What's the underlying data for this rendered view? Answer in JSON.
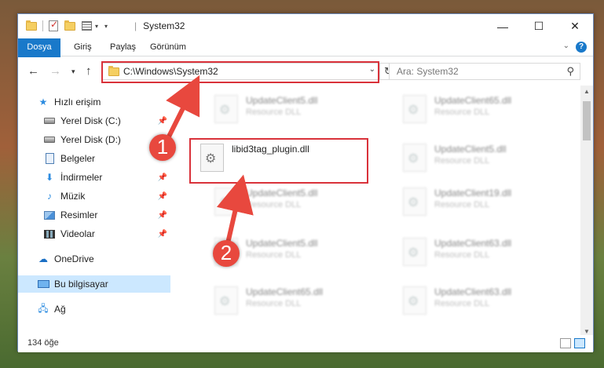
{
  "window": {
    "title": "System32",
    "controls": {
      "minimize": "—",
      "maximize": "☐",
      "close": "✕"
    }
  },
  "ribbon": {
    "tabs": [
      "Dosya",
      "Giriş",
      "Paylaş",
      "Görünüm"
    ],
    "help": "?"
  },
  "navbar": {
    "address": "C:\\Windows\\System32",
    "search_placeholder": "Ara: System32"
  },
  "sidebar": {
    "items": [
      {
        "label": "Hızlı erişim",
        "icon": "star-icon"
      },
      {
        "label": "Yerel Disk (C:)",
        "icon": "disk-icon",
        "pinned": true
      },
      {
        "label": "Yerel Disk (D:)",
        "icon": "disk-icon"
      },
      {
        "label": "Belgeler",
        "icon": "documents-icon"
      },
      {
        "label": "İndirmeler",
        "icon": "download-icon",
        "pinned": true
      },
      {
        "label": "Müzik",
        "icon": "music-icon",
        "pinned": true
      },
      {
        "label": "Resimler",
        "icon": "pictures-icon",
        "pinned": true
      },
      {
        "label": "Videolar",
        "icon": "videos-icon",
        "pinned": true
      },
      {
        "label": "OneDrive",
        "icon": "cloud-icon"
      },
      {
        "label": "Bu bilgisayar",
        "icon": "computer-icon",
        "selected": true
      },
      {
        "label": "Ağ",
        "icon": "network-icon"
      }
    ]
  },
  "files": {
    "left_column": [
      {
        "name": "UpdateClient5.dll",
        "type": "Resource DLL"
      },
      {
        "name": "libid3tag_plugin.dll",
        "type": ""
      },
      {
        "name": "UpdateClient5.dll",
        "type": "Resource DLL"
      },
      {
        "name": "UpdateClient5.dll",
        "type": "Resource DLL"
      },
      {
        "name": "UpdateClient65.dll",
        "type": "Resource DLL"
      }
    ],
    "right_column": [
      {
        "name": "UpdateClient65.dll",
        "type": "Resource DLL"
      },
      {
        "name": "UpdateClient5.dll",
        "type": "Resource DLL"
      },
      {
        "name": "UpdateClient19.dll",
        "type": "Resource DLL"
      },
      {
        "name": "UpdateClient63.dll",
        "type": "Resource DLL"
      },
      {
        "name": "UpdateClient63.dll",
        "type": "Resource DLL"
      }
    ]
  },
  "status": {
    "count": "134 öğe"
  },
  "annotations": {
    "step1": "1",
    "step2": "2",
    "color": "#d9323a"
  }
}
